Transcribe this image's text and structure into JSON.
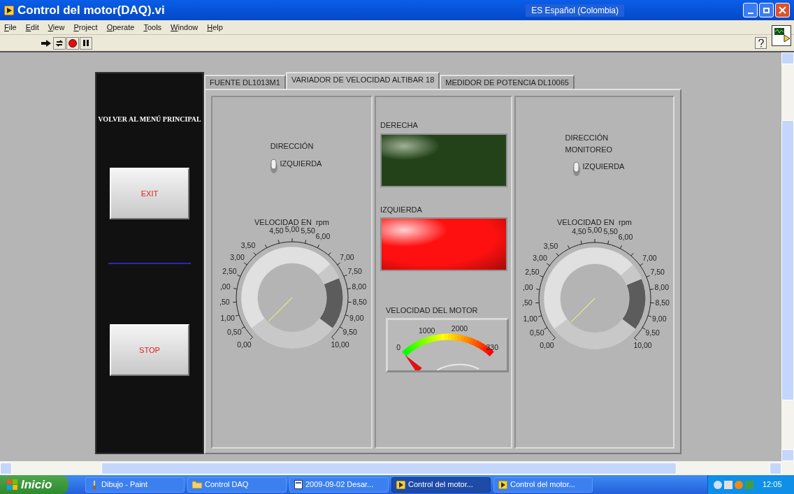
{
  "window": {
    "title": "Control del motor(DAQ).vi",
    "language_bar": "ES Español (Colombia)"
  },
  "menu": [
    "File",
    "Edit",
    "View",
    "Project",
    "Operate",
    "Tools",
    "Window",
    "Help"
  ],
  "sidebar": {
    "label": "VOLVER AL MENÚ PRINCIPAL",
    "buttons": [
      "EXIT",
      "STOP"
    ]
  },
  "tabs": [
    {
      "label": "FUENTE DL1013M1",
      "selected": false
    },
    {
      "label": "VARIADOR DE VELOCIDAD ALTIBAR 18",
      "selected": true
    },
    {
      "label": "MEDIDOR DE POTENCIA DL10065",
      "selected": false
    }
  ],
  "control_panel": {
    "switch": {
      "label": "DIRECCIÓN",
      "state_label": "IZQUIERDA",
      "on": false
    },
    "knob": {
      "label": "VELOCIDAD EN  rpm",
      "scale": [
        "4,50",
        "5,00",
        "5,50",
        "6,00",
        "3,50",
        "3,00",
        "7,00",
        "2,50",
        "7,50",
        ",00",
        "8,00",
        ",50",
        "8,50",
        "1,00",
        "9,00",
        "0,50",
        "9,50",
        "0,00",
        "10,00"
      ]
    }
  },
  "indicators_panel": {
    "leds": [
      {
        "label": "DERECHA",
        "color": "#24421a",
        "on": false
      },
      {
        "label": "IZQUIERDA",
        "color": "#ff1010",
        "on": true
      }
    ],
    "gauge": {
      "label": "VELOCIDAD DEL MOTOR",
      "scale": [
        "0",
        "1000",
        "2000",
        "330"
      ]
    }
  },
  "monitor_panel": {
    "switch": {
      "label": "DIRECCIÓN MONITOREO",
      "state_label": "IZQUIERDA",
      "on": false
    },
    "knob": {
      "label": "VELOCIDAD EN  rpm",
      "scale": [
        "4,50",
        "5,00",
        "5,50",
        "6,00",
        "3,50",
        "3,00",
        "7,00",
        "2,50",
        "7,50",
        ",00",
        "8,00",
        ",50",
        "8,50",
        "1,00",
        "9,00",
        "0,50",
        "9,50",
        "0,00",
        "10,00"
      ]
    }
  },
  "taskbar": {
    "start": "Inicio",
    "tasks": [
      {
        "label": "Dibujo - Paint",
        "kind": "paint",
        "selected": false
      },
      {
        "label": "Control DAQ",
        "kind": "folder",
        "selected": false
      },
      {
        "label": "2009-09-02 Desar...",
        "kind": "document",
        "selected": false
      },
      {
        "label": "Control del motor...",
        "kind": "labview",
        "selected": true
      },
      {
        "label": "Control del motor...",
        "kind": "labview",
        "selected": false
      }
    ],
    "clock": "12:05"
  }
}
